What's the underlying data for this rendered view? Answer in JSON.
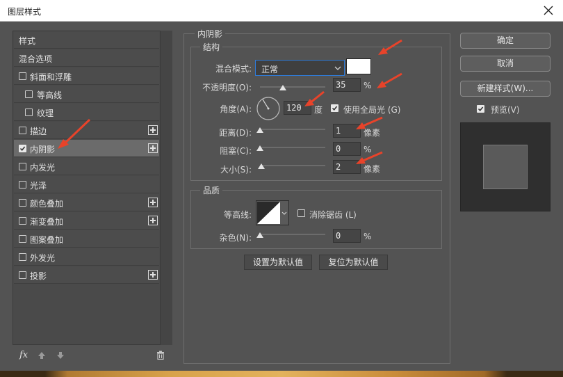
{
  "window": {
    "title": "图层样式"
  },
  "styles_list": {
    "items": [
      {
        "label": "样式",
        "checkbox": false,
        "checked": false,
        "plus": false,
        "indent": 0,
        "selected": false
      },
      {
        "label": "混合选项",
        "checkbox": false,
        "checked": false,
        "plus": false,
        "indent": 0,
        "selected": false
      },
      {
        "label": "斜面和浮雕",
        "checkbox": true,
        "checked": false,
        "plus": false,
        "indent": 0,
        "selected": false
      },
      {
        "label": "等高线",
        "checkbox": true,
        "checked": false,
        "plus": false,
        "indent": 1,
        "selected": false
      },
      {
        "label": "纹理",
        "checkbox": true,
        "checked": false,
        "plus": false,
        "indent": 1,
        "selected": false
      },
      {
        "label": "描边",
        "checkbox": true,
        "checked": false,
        "plus": true,
        "indent": 0,
        "selected": false
      },
      {
        "label": "内阴影",
        "checkbox": true,
        "checked": true,
        "plus": true,
        "indent": 0,
        "selected": true
      },
      {
        "label": "内发光",
        "checkbox": true,
        "checked": false,
        "plus": false,
        "indent": 0,
        "selected": false
      },
      {
        "label": "光泽",
        "checkbox": true,
        "checked": false,
        "plus": false,
        "indent": 0,
        "selected": false
      },
      {
        "label": "颜色叠加",
        "checkbox": true,
        "checked": false,
        "plus": true,
        "indent": 0,
        "selected": false
      },
      {
        "label": "渐变叠加",
        "checkbox": true,
        "checked": false,
        "plus": true,
        "indent": 0,
        "selected": false
      },
      {
        "label": "图案叠加",
        "checkbox": true,
        "checked": false,
        "plus": false,
        "indent": 0,
        "selected": false
      },
      {
        "label": "外发光",
        "checkbox": true,
        "checked": false,
        "plus": false,
        "indent": 0,
        "selected": false
      },
      {
        "label": "投影",
        "checkbox": true,
        "checked": false,
        "plus": true,
        "indent": 0,
        "selected": false
      }
    ],
    "footer_fx": "fx"
  },
  "inner_shadow": {
    "title": "内阴影",
    "structure": {
      "title": "结构",
      "blend_mode_label": "混合模式:",
      "blend_mode_value": "正常",
      "shadow_color": "#ffffff",
      "opacity_label": "不透明度(O):",
      "opacity_value": "35",
      "opacity_unit": "%",
      "angle_label": "角度(A):",
      "angle_value": "120",
      "angle_unit": "度",
      "global_light_label": "使用全局光 (G)",
      "global_light_checked": true,
      "distance_label": "距离(D):",
      "distance_value": "1",
      "distance_unit": "像素",
      "choke_label": "阻塞(C):",
      "choke_value": "0",
      "choke_unit": "%",
      "size_label": "大小(S):",
      "size_value": "2",
      "size_unit": "像素"
    },
    "quality": {
      "title": "品质",
      "contour_label": "等高线:",
      "antialias_label": "消除锯齿 (L)",
      "antialias_checked": false,
      "noise_label": "杂色(N):",
      "noise_value": "0",
      "noise_unit": "%"
    },
    "set_default_label": "设置为默认值",
    "reset_default_label": "复位为默认值"
  },
  "actions": {
    "ok_label": "确定",
    "cancel_label": "取消",
    "new_style_label": "新建样式(W)...",
    "preview_label": "预览(V)",
    "preview_checked": true
  },
  "colors": {
    "dialog_bg": "#535353",
    "annotation_arrow": "#e8432a"
  }
}
